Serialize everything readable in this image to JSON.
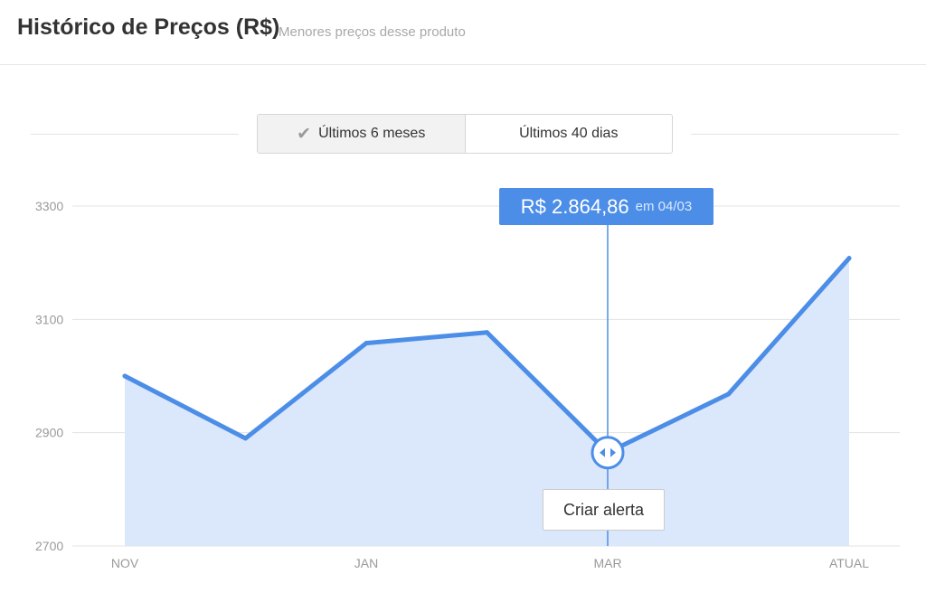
{
  "header": {
    "title": "Histórico de Preços (R$)",
    "subtitle": "Menores preços desse produto"
  },
  "period_toggle": {
    "options": [
      {
        "label": "Últimos 6 meses",
        "selected": true,
        "icon": "check-icon"
      },
      {
        "label": "Últimos 40 dias",
        "selected": false
      }
    ]
  },
  "tooltip": {
    "price": "R$ 2.864,86",
    "date": "em 04/03"
  },
  "alert_button": {
    "label": "Criar alerta"
  },
  "colors": {
    "line": "#4c8ee7",
    "area": "#dbe8fb",
    "tooltip_bg": "#4c8ee7",
    "grid": "#e3e3e3",
    "axis_text": "#9a9a9a"
  },
  "chart_data": {
    "type": "area",
    "x": [
      "NOV",
      "",
      "JAN",
      "",
      "MAR",
      "",
      "ATUAL"
    ],
    "x_tick_labels": [
      "NOV",
      "JAN",
      "MAR",
      "ATUAL"
    ],
    "series": [
      {
        "values": [
          3000,
          2890,
          3058,
          3077,
          2865,
          2968,
          3208
        ]
      }
    ],
    "y_ticks": [
      2700,
      2900,
      3100,
      3300
    ],
    "ylim": [
      2700,
      3300
    ],
    "grid": true,
    "highlight": {
      "index": 4,
      "value": 2864.86,
      "label": "R$ 2.864,86",
      "date": "04/03"
    }
  }
}
